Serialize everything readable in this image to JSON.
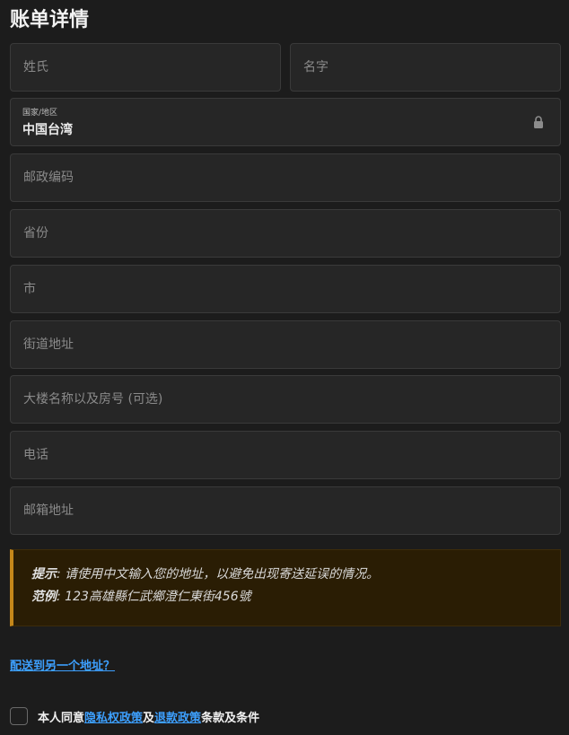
{
  "page": {
    "title": "账单详情"
  },
  "form": {
    "last_name_placeholder": "姓氏",
    "first_name_placeholder": "名字",
    "country_label": "国家/地区",
    "country_value": "中国台湾",
    "postcode_placeholder": "邮政编码",
    "province_placeholder": "省份",
    "city_placeholder": "市",
    "street_placeholder": "街道地址",
    "building_placeholder": "大楼名称以及房号 (可选)",
    "phone_placeholder": "电话",
    "email_placeholder": "邮箱地址"
  },
  "notice": {
    "tip_label": "提示",
    "tip_sep": ":",
    "tip_text": "请使用中文输入您的地址，以避免出现寄送延误的情况。",
    "example_label": "范例",
    "example_sep": ":",
    "example_text": "123高雄縣仁武鄉澄仁東街456號"
  },
  "ship_link": "配送到另一个地址？",
  "terms": {
    "prefix": "本人同意",
    "privacy_link": "隐私权政策",
    "middle": "及",
    "refund_link": "退款政策",
    "suffix": "条款及条件"
  },
  "colors": {
    "background": "#1c1c1c",
    "field_bg": "#262626",
    "accent_link": "#3da0ff",
    "notice_border": "#c4871a",
    "notice_bg": "#2a1d04"
  },
  "icons": {
    "country_lock": "lock-icon"
  }
}
